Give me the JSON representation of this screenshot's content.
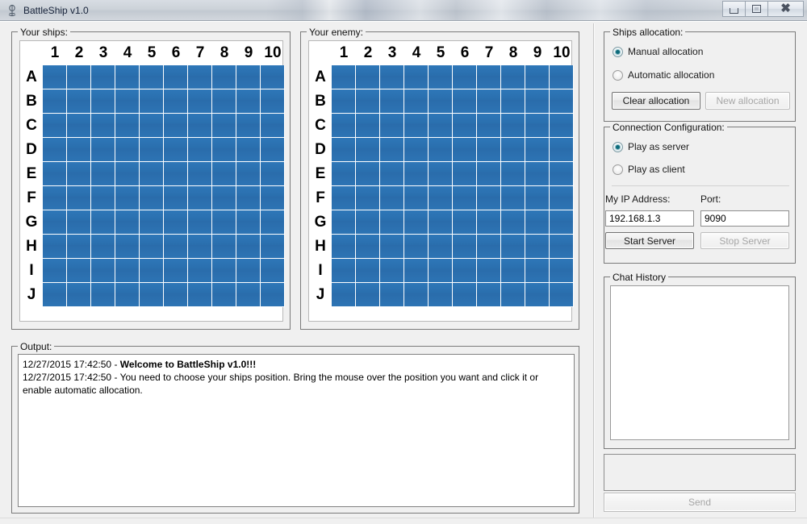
{
  "window": {
    "title": "BattleShip v1.0",
    "icon": "app-ship-icon",
    "controls": {
      "minimize": "minimize-icon",
      "maximize": "maximize-icon",
      "close": "close-icon"
    }
  },
  "boards": {
    "player": {
      "legend": "Your ships:"
    },
    "enemy": {
      "legend": "Your enemy:"
    },
    "columns": [
      "1",
      "2",
      "3",
      "4",
      "5",
      "6",
      "7",
      "8",
      "9",
      "10"
    ],
    "rows": [
      "A",
      "B",
      "C",
      "D",
      "E",
      "F",
      "G",
      "H",
      "I",
      "J"
    ],
    "cell_color": "#2a6fae",
    "cell_state": "water"
  },
  "output": {
    "legend": "Output:",
    "lines": [
      {
        "timestamp": "12/27/2015 17:42:50",
        "separator": " - ",
        "text": "Welcome to BattleShip v1.0!!!",
        "bold": true
      },
      {
        "timestamp": "12/27/2015 17:42:50",
        "separator": " - ",
        "text": "You need to choose your ships position. Bring the mouse over the position you want and click it or enable automatic allocation.",
        "bold": false
      }
    ]
  },
  "ships_allocation": {
    "legend": "Ships allocation:",
    "options": [
      {
        "label": "Manual allocation",
        "checked": true
      },
      {
        "label": "Automatic allocation",
        "checked": false
      }
    ],
    "buttons": [
      {
        "label": "Clear allocation",
        "enabled": true
      },
      {
        "label": "New allocation",
        "enabled": false
      }
    ]
  },
  "connection": {
    "legend": "Connection Configuration:",
    "options": [
      {
        "label": "Play as server",
        "checked": true
      },
      {
        "label": "Play as client",
        "checked": false
      }
    ],
    "ip_label": "My IP Address:",
    "ip_value": "192.168.1.3",
    "port_label": "Port:",
    "port_value": "9090",
    "buttons": [
      {
        "label": "Start Server",
        "enabled": true
      },
      {
        "label": "Stop Server",
        "enabled": false
      }
    ]
  },
  "chat": {
    "legend": "Chat History",
    "history": "",
    "input_value": "",
    "send_label": "Send",
    "send_enabled": false
  }
}
